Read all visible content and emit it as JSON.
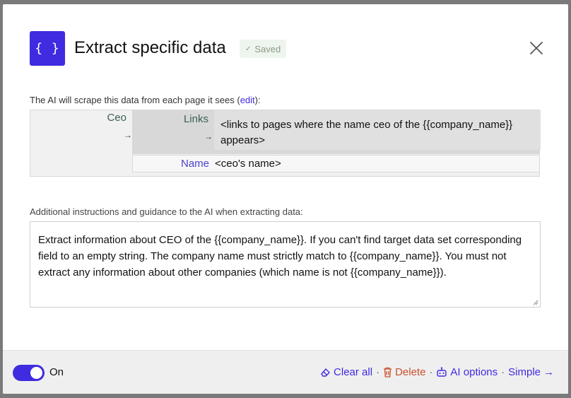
{
  "header": {
    "icon_glyph": "{ }",
    "title": "Extract specific data",
    "saved_label": "Saved"
  },
  "schema": {
    "caption_prefix": "The AI will scrape this data from each page it sees (",
    "caption_link": "edit",
    "caption_suffix": "):",
    "root_label": "Ceo",
    "links_label": "Links",
    "links_value": "<links to pages where the name ceo of the {{company_name}} appears>",
    "name_label": "Name",
    "name_value": "<ceo's name>",
    "arrow": "→"
  },
  "instructions": {
    "caption": "Additional instructions and guidance to the AI when extracting data:",
    "value": "Extract information about CEO of the {{company_name}}. If you can't find target data set corresponding field to an empty string. The company name must strictly match to {{company_name}}. You must not extract any information about other companies (which name is not {{company_name}})."
  },
  "footer": {
    "toggle_on": true,
    "toggle_label": "On",
    "clear_all": "Clear all",
    "delete": "Delete",
    "ai_options": "AI options",
    "simple": "Simple",
    "separator": "·",
    "simple_arrow": "→"
  },
  "colors": {
    "accent": "#3f2be0",
    "danger": "#c8502e",
    "field_label": "#3c6050"
  },
  "icons": [
    "braces-icon",
    "check-icon",
    "close-icon",
    "eraser-icon",
    "trash-icon",
    "robot-icon",
    "arrow-right-icon"
  ]
}
